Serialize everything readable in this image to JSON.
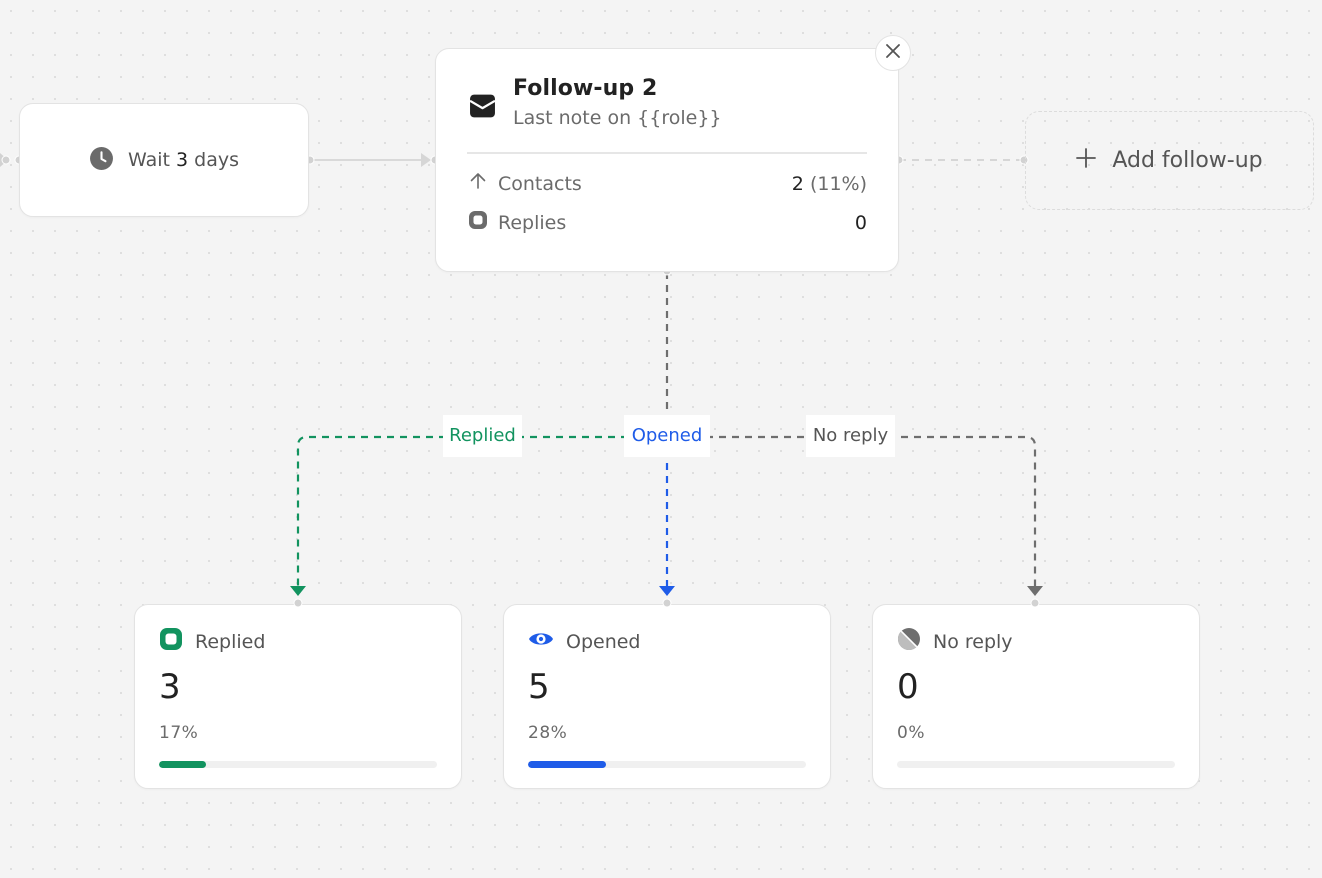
{
  "wait_node": {
    "label": "Wait",
    "amount": "3",
    "unit": "days",
    "icon": "clock-icon"
  },
  "step_node": {
    "title": "Follow-up 2",
    "subtitle": "Last note on {{role}}",
    "icon": "envelope-icon",
    "contacts_label": "Contacts",
    "contacts_value": "2",
    "contacts_pct": "(11%)",
    "replies_label": "Replies",
    "replies_value": "0"
  },
  "add_node": {
    "label": "Add follow-up"
  },
  "branches": [
    {
      "label": "Replied",
      "color": "#12935f"
    },
    {
      "label": "Opened",
      "color": "#1f5ce8"
    },
    {
      "label": "No reply",
      "color": "#6e6e6e"
    }
  ],
  "results": [
    {
      "name": "Replied",
      "count": "3",
      "pct": "17%",
      "fraction": 0.17,
      "color": "#12935f",
      "icon": "reply-bubble-icon"
    },
    {
      "name": "Opened",
      "count": "5",
      "pct": "28%",
      "fraction": 0.28,
      "color": "#1f5ce8",
      "icon": "eye-icon"
    },
    {
      "name": "No reply",
      "count": "0",
      "pct": "0%",
      "fraction": 0,
      "color": "#6e6e6e",
      "icon": "no-reply-icon"
    }
  ]
}
